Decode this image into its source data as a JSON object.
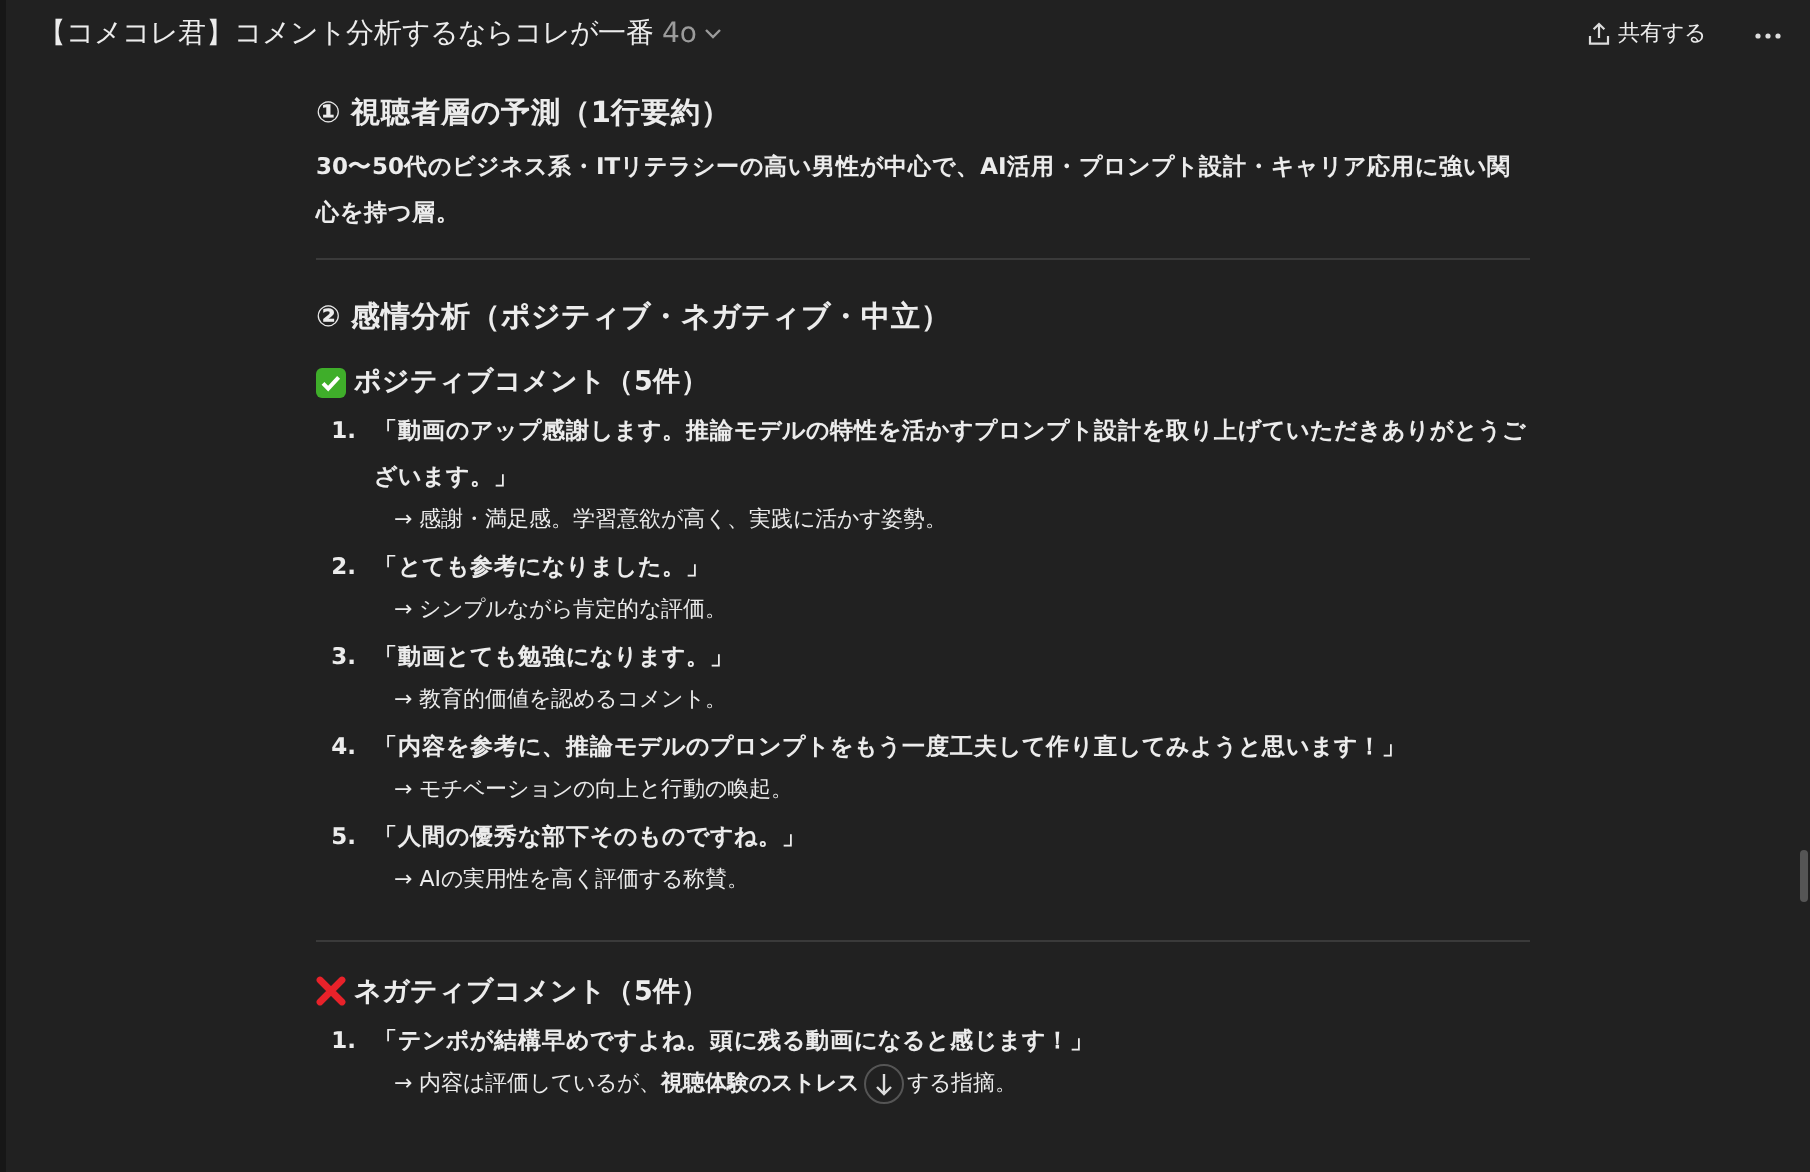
{
  "header": {
    "title": "【コメコレ君】コメント分析するならコレが一番",
    "model": "4o",
    "share": "共有する"
  },
  "sections": [
    {
      "kind": "summary",
      "heading": "① 視聴者層の予測（1行要約）",
      "text": "30〜50代のビジネス系・ITリテラシーの高い男性が中心で、AI活用・プロンプト設計・キャリア応用に強い関心を持つ層。"
    },
    {
      "kind": "sentiment",
      "heading": "② 感情分析（ポジティブ・ネガティブ・中立）",
      "groups": [
        {
          "kind": "positive",
          "title": "ポジティブコメント（5件）",
          "items": [
            {
              "number": "1.",
              "quote": "「動画のアップ感謝します。推論モデルの特性を活かすプロンプト設計を取り上げていただきありがとうございます。」",
              "note": "→ 感謝・満足感。学習意欲が高く、実践に活かす姿勢。"
            },
            {
              "number": "2.",
              "quote": "「とても参考になりました。」",
              "note": "→ シンプルながら肯定的な評価。"
            },
            {
              "number": "3.",
              "quote": "「動画とても勉強になります。」",
              "note": "→ 教育的価値を認めるコメント。"
            },
            {
              "number": "4.",
              "quote": "「内容を参考に、推論モデルのプロンプトをもう一度工夫して作り直してみようと思います！」",
              "note": "→ モチベーションの向上と行動の喚起。"
            },
            {
              "number": "5.",
              "quote": "「人間の優秀な部下そのものですね。」",
              "note": "→ AIの実用性を高く評価する称賛。"
            }
          ]
        },
        {
          "kind": "negative",
          "title": "ネガティブコメント（5件）",
          "items": [
            {
              "number": "1.",
              "quote": "「テンポが結構早めですよね。頭に残る動画になると感じます！」",
              "note": "→ 内容は評価しているが、**視聴体験のストレス**",
              "note_after": "する指摘。"
            }
          ]
        }
      ]
    }
  ]
}
